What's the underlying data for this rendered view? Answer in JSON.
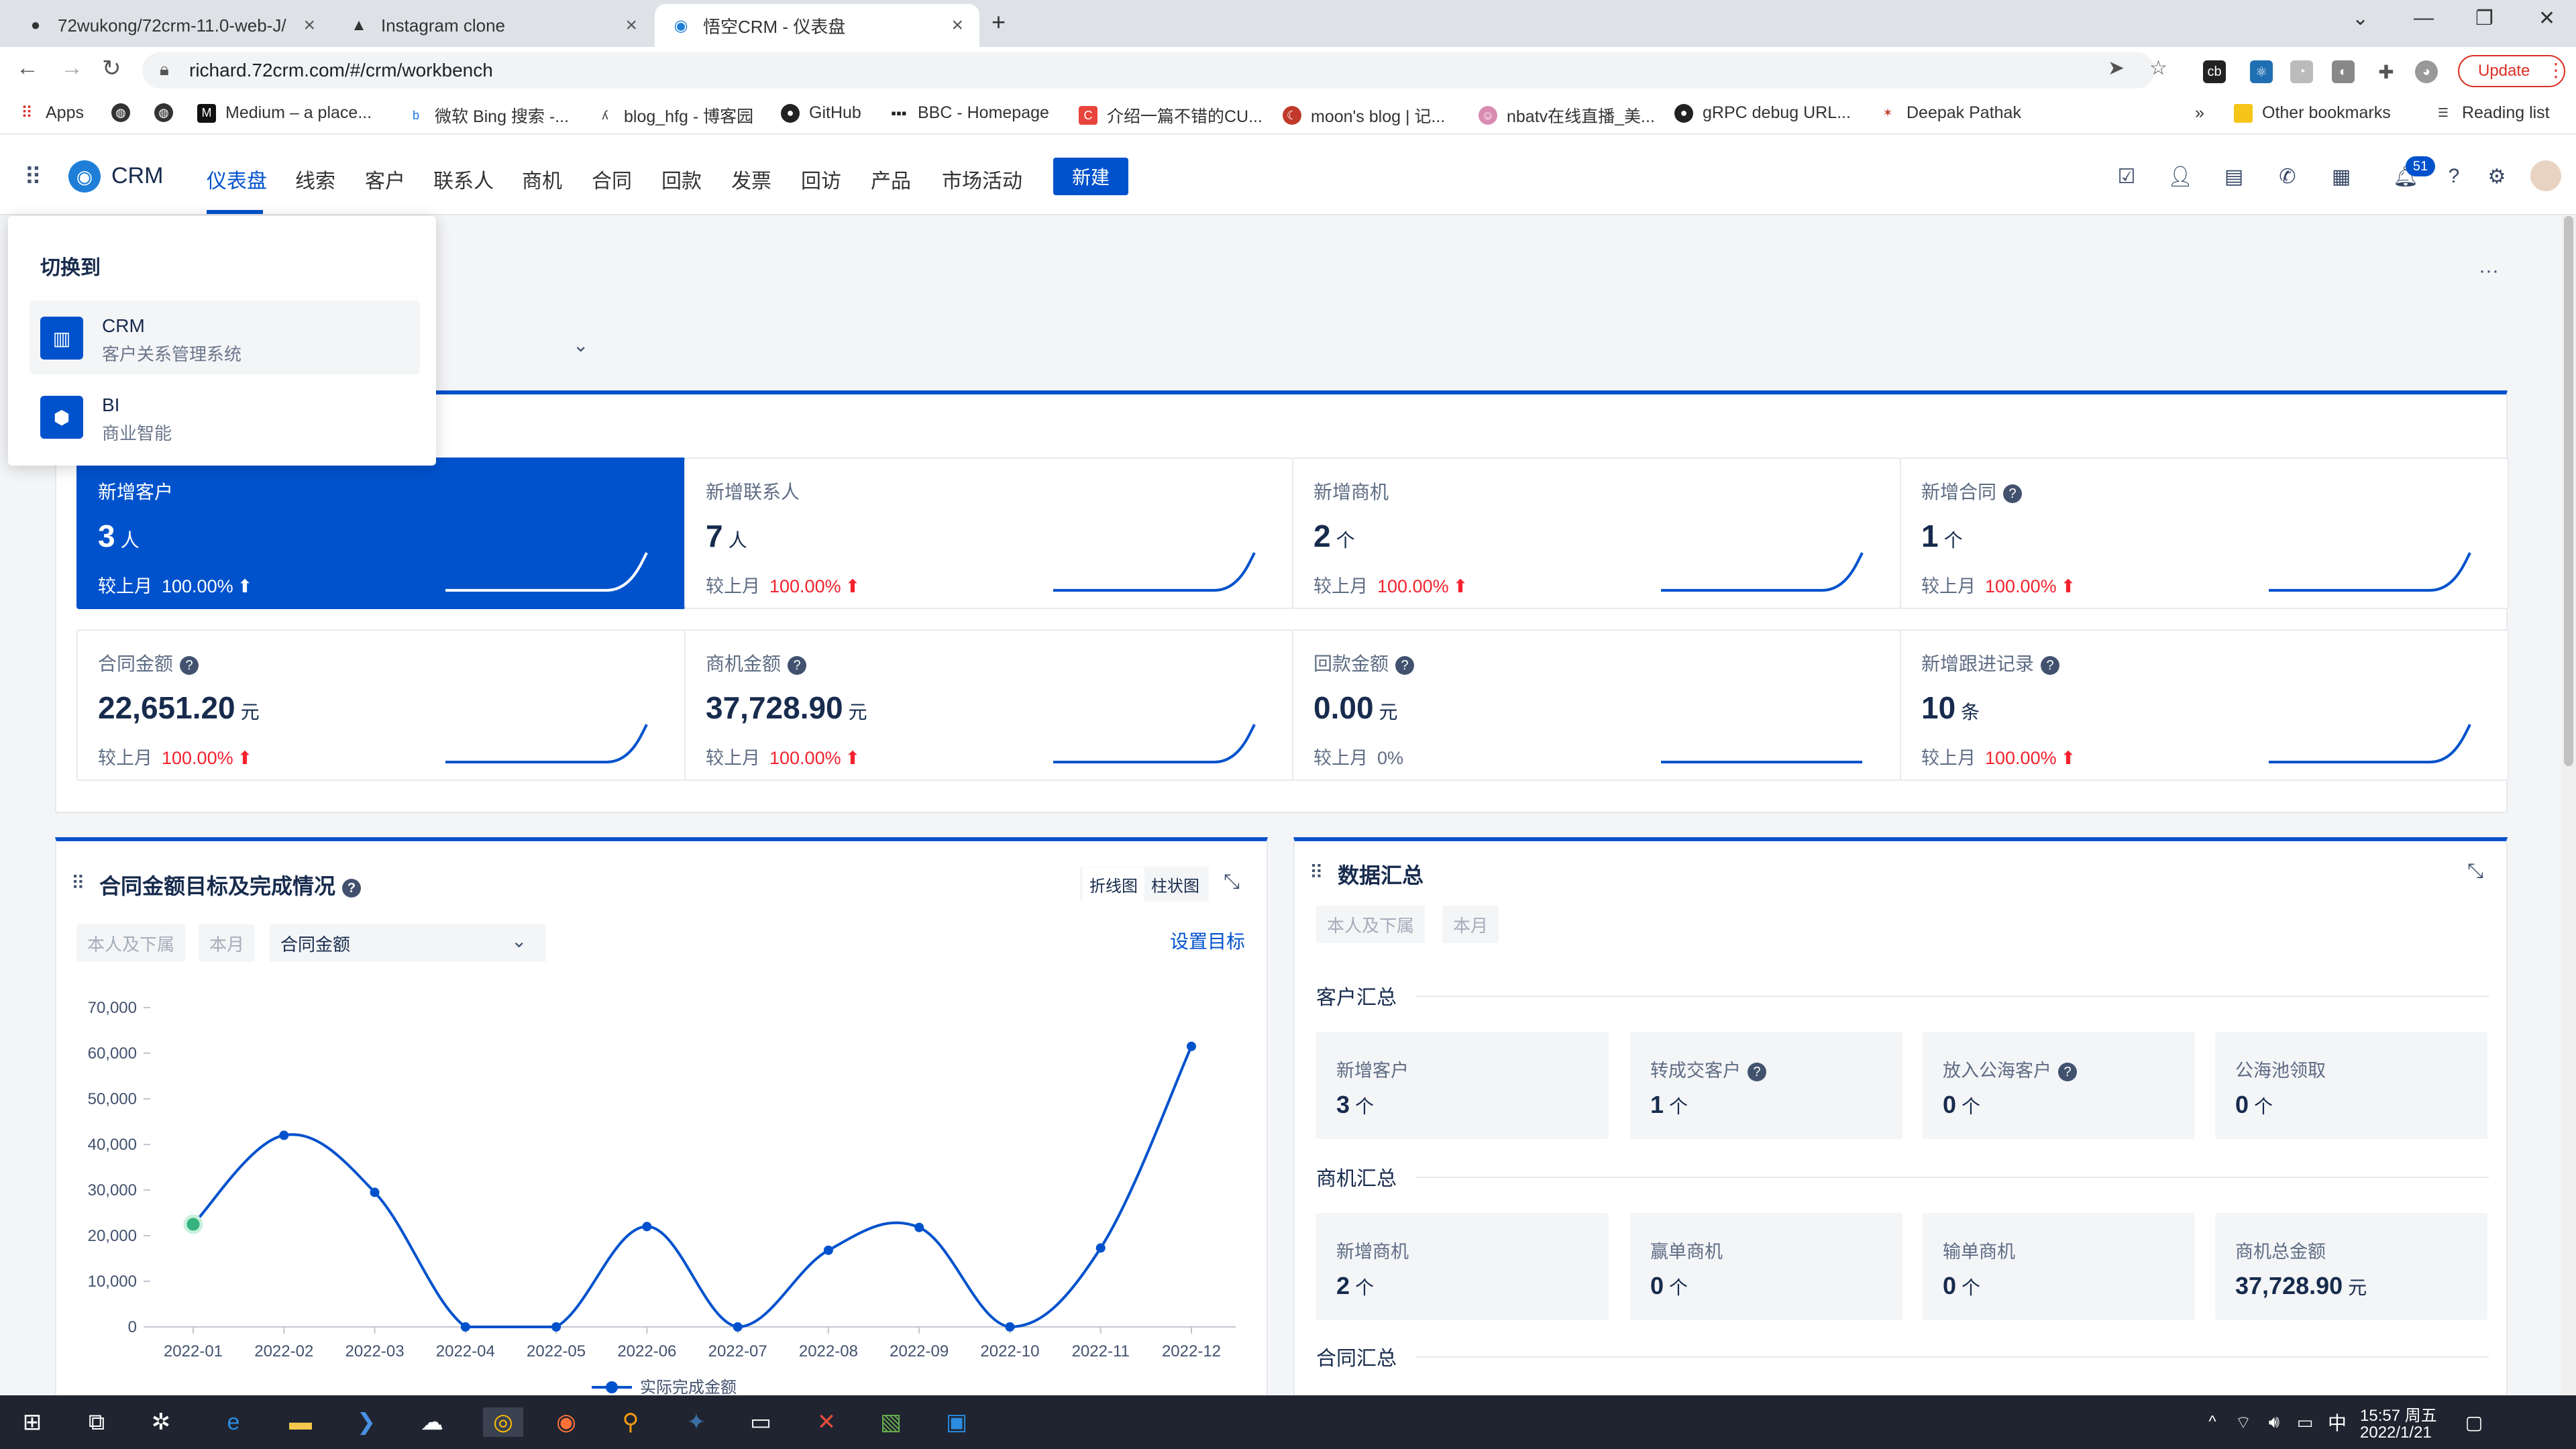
{
  "browser": {
    "tabs": [
      {
        "title": "72wukong/72crm-11.0-web-J/",
        "icon": "github-icon"
      },
      {
        "title": "Instagram clone",
        "icon": "triangle-icon"
      },
      {
        "title": "悟空CRM - 仪表盘",
        "icon": "wukong-icon"
      }
    ],
    "url": "richard.72crm.com/#/crm/workbench",
    "update_label": "Update",
    "bookmarks": [
      "Apps",
      "Medium – a place...",
      "微软 Bing 搜索 -...",
      "blog_hfg - 博客园",
      "GitHub",
      "BBC - Homepage",
      "介绍一篇不错的CU...",
      "moon's blog | 记...",
      "nbatv在线直播_美...",
      "gRPC debug URL...",
      "Deepak Pathak"
    ],
    "overflow": "»",
    "other_bookmarks": "Other bookmarks",
    "reading_list": "Reading list"
  },
  "app": {
    "logo": "CRM",
    "nav": [
      "仪表盘",
      "线索",
      "客户",
      "联系人",
      "商机",
      "合同",
      "回款",
      "发票",
      "回访",
      "产品",
      "市场活动"
    ],
    "new_button": "新建",
    "notification_count": "51",
    "more": "···"
  },
  "switcher": {
    "title": "切换到",
    "items": [
      {
        "name": "CRM",
        "desc": "客户关系管理系统"
      },
      {
        "name": "BI",
        "desc": "商业智能"
      }
    ]
  },
  "stats": [
    {
      "title": "新增客户",
      "value": "3",
      "unit": "人",
      "compare": "较上月",
      "pct": "100.00%",
      "arrow": "⬆"
    },
    {
      "title": "新增联系人",
      "value": "7",
      "unit": "人",
      "compare": "较上月",
      "pct": "100.00%",
      "arrow": "⬆"
    },
    {
      "title": "新增商机",
      "value": "2",
      "unit": "个",
      "compare": "较上月",
      "pct": "100.00%",
      "arrow": "⬆"
    },
    {
      "title": "新增合同",
      "value": "1",
      "unit": "个",
      "compare": "较上月",
      "pct": "100.00%",
      "arrow": "⬆"
    },
    {
      "title": "合同金额",
      "value": "22,651.20",
      "unit": "元",
      "compare": "较上月",
      "pct": "100.00%",
      "arrow": "⬆"
    },
    {
      "title": "商机金额",
      "value": "37,728.90",
      "unit": "元",
      "compare": "较上月",
      "pct": "100.00%",
      "arrow": "⬆"
    },
    {
      "title": "回款金额",
      "value": "0.00",
      "unit": "元",
      "compare": "较上月",
      "pct": "0%",
      "arrow": ""
    },
    {
      "title": "新增跟进记录",
      "value": "10",
      "unit": "条",
      "compare": "较上月",
      "pct": "100.00%",
      "arrow": "⬆"
    }
  ],
  "contract_panel": {
    "title": "合同金额目标及完成情况",
    "toggle_line": "折线图",
    "toggle_bar": "柱状图",
    "filter_scope": "本人及下属",
    "filter_period": "本月",
    "metric_select": "合同金额",
    "set_target": "设置目标",
    "legend_label": "实际完成金额"
  },
  "summary_panel": {
    "title": "数据汇总",
    "filter_scope": "本人及下属",
    "filter_period": "本月",
    "sections": [
      {
        "title": "客户汇总",
        "items": [
          {
            "label": "新增客户",
            "value": "3",
            "unit": "个",
            "help": false
          },
          {
            "label": "转成交客户",
            "value": "1",
            "unit": "个",
            "help": true
          },
          {
            "label": "放入公海客户",
            "value": "0",
            "unit": "个",
            "help": true
          },
          {
            "label": "公海池领取",
            "value": "0",
            "unit": "个",
            "help": false
          }
        ]
      },
      {
        "title": "商机汇总",
        "items": [
          {
            "label": "新增商机",
            "value": "2",
            "unit": "个",
            "help": false
          },
          {
            "label": "赢单商机",
            "value": "0",
            "unit": "个",
            "help": false
          },
          {
            "label": "输单商机",
            "value": "0",
            "unit": "个",
            "help": false
          },
          {
            "label": "商机总金额",
            "value": "37,728.90",
            "unit": "元",
            "help": false
          }
        ]
      },
      {
        "title": "合同汇总",
        "items": []
      }
    ]
  },
  "chart_data": {
    "type": "line",
    "x": [
      "2022-01",
      "2022-02",
      "2022-03",
      "2022-04",
      "2022-05",
      "2022-06",
      "2022-07",
      "2022-08",
      "2022-09",
      "2022-10",
      "2022-11",
      "2022-12"
    ],
    "series": [
      {
        "name": "实际完成金额",
        "values": [
          22500,
          42000,
          29500,
          0,
          0,
          22000,
          0,
          16800,
          21800,
          0,
          17300,
          61500
        ],
        "color": "#0052cc"
      }
    ],
    "yticks": [
      "70,000",
      "60,000",
      "50,000",
      "40,000",
      "30,000",
      "20,000",
      "10,000",
      "0"
    ],
    "ylim": [
      0,
      70000
    ],
    "highlight_index": 0,
    "highlight_color": "#36b37e",
    "grid": false
  },
  "taskbar": {
    "time": "15:57 周五",
    "date": "2022/1/21",
    "ime": "中"
  },
  "colors": {
    "accent": "#0052cc",
    "danger": "#f5222d"
  }
}
